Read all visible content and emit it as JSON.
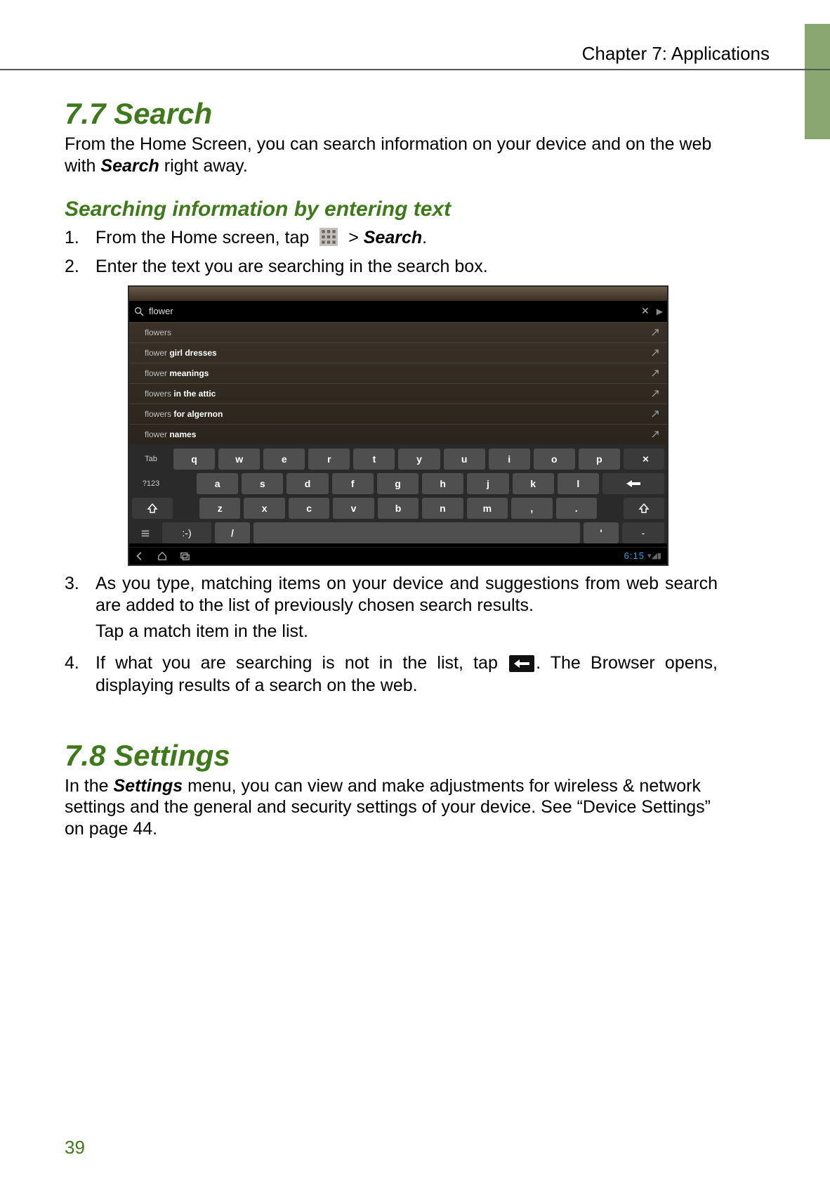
{
  "header": {
    "chapter": "Chapter 7: Applications"
  },
  "section1": {
    "heading": "7.7 Search",
    "intro_prefix": "From the Home Screen, you can search information on your device and on the web with ",
    "intro_em": "Search",
    "intro_suffix": " right away.",
    "sub_heading": "Searching information by entering text",
    "step1": {
      "num": "1.",
      "a": "From the Home screen, tap ",
      "b": " > ",
      "c": "Search",
      "d": "."
    },
    "step2": {
      "num": "2.",
      "text": "Enter the text you are searching in the search box."
    },
    "step3": {
      "num": "3.",
      "text": "As you type, matching items on your device and suggestions from web search are added to the list of previously chosen search results.",
      "sub": "Tap a match item in the list."
    },
    "step4": {
      "num": "4.",
      "a": "If what you are searching is not in the list, tap ",
      "b": ". The Browser opens, displaying results of a search on the web."
    }
  },
  "screenshot": {
    "query": "flower",
    "suggestions": [
      {
        "plain": "flowers",
        "bold": ""
      },
      {
        "plain": "flower ",
        "bold": "girl dresses"
      },
      {
        "plain": "flower ",
        "bold": "meanings"
      },
      {
        "plain": "flowers ",
        "bold": "in the attic"
      },
      {
        "plain": "flowers ",
        "bold": "for algernon"
      },
      {
        "plain": "flower ",
        "bold": "names"
      }
    ],
    "keyboard": {
      "row1_label": "Tab",
      "row1": [
        "q",
        "w",
        "e",
        "r",
        "t",
        "y",
        "u",
        "i",
        "o",
        "p"
      ],
      "row2_label": "?123",
      "row2": [
        "a",
        "s",
        "d",
        "f",
        "g",
        "h",
        "j",
        "k",
        "l"
      ],
      "row3": [
        "z",
        "x",
        "c",
        "v",
        "b",
        "n",
        "m",
        ",",
        "."
      ],
      "row4_left": ":-)",
      "row4_slash": "/",
      "row4_apos": "'",
      "row4_dash": "-"
    },
    "clock": "6:15"
  },
  "section2": {
    "heading": "7.8 Settings",
    "a": "In the ",
    "b": "Settings",
    "c": " menu, you can view and make adjustments for wireless & network settings and the general and security settings of your device. See “Device Settings” on page 44."
  },
  "page_number": "39"
}
